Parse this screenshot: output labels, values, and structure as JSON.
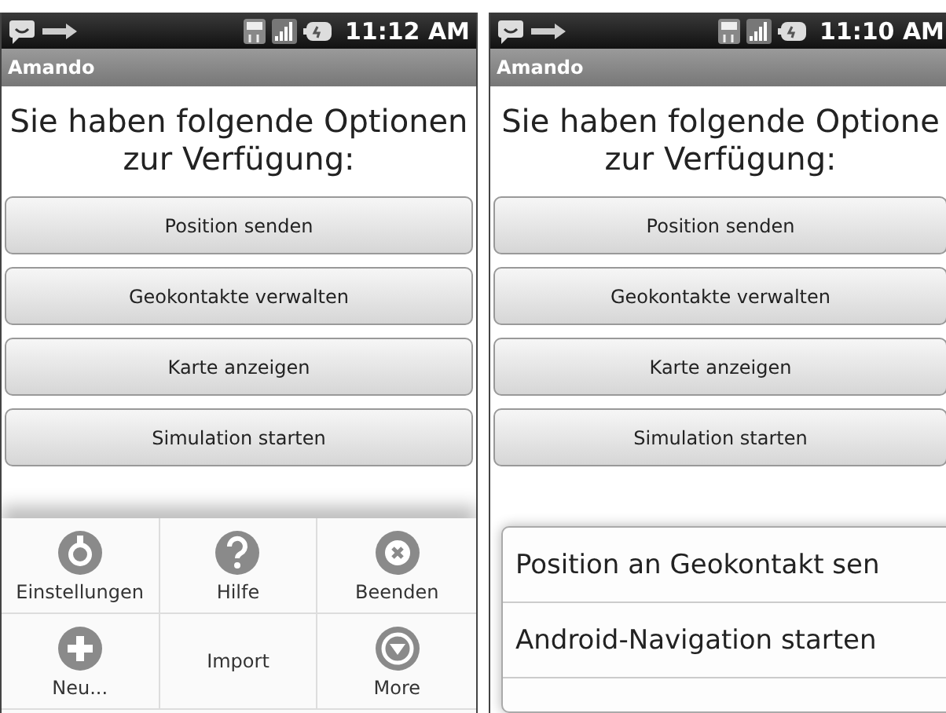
{
  "phones": [
    {
      "status_bar": {
        "time": "11:12 AM"
      },
      "app_title": "Amando",
      "heading": "Sie haben folgende Optionen zur Verfügung:",
      "buttons": [
        "Position senden",
        "Geokontakte verwalten",
        "Karte anzeigen",
        "Simulation starten"
      ],
      "menu": {
        "kind": "options",
        "items": [
          {
            "label": "Einstellungen",
            "kind": "settings"
          },
          {
            "label": "Hilfe",
            "kind": "help"
          },
          {
            "label": "Beenden",
            "kind": "close"
          },
          {
            "label": "Neu...",
            "kind": "add"
          },
          {
            "label": "Import",
            "kind": "text"
          },
          {
            "label": "More",
            "kind": "more"
          }
        ]
      }
    },
    {
      "status_bar": {
        "time": "11:10 AM"
      },
      "app_title": "Amando",
      "heading": "Sie haben folgende Optione zur Verfügung:",
      "buttons": [
        "Position senden",
        "Geokontakte verwalten",
        "Karte anzeigen",
        "Simulation starten"
      ],
      "menu": {
        "kind": "context",
        "items": [
          {
            "label": "Position an Geokontakt sen"
          },
          {
            "label": "Android-Navigation starten"
          }
        ]
      }
    }
  ]
}
